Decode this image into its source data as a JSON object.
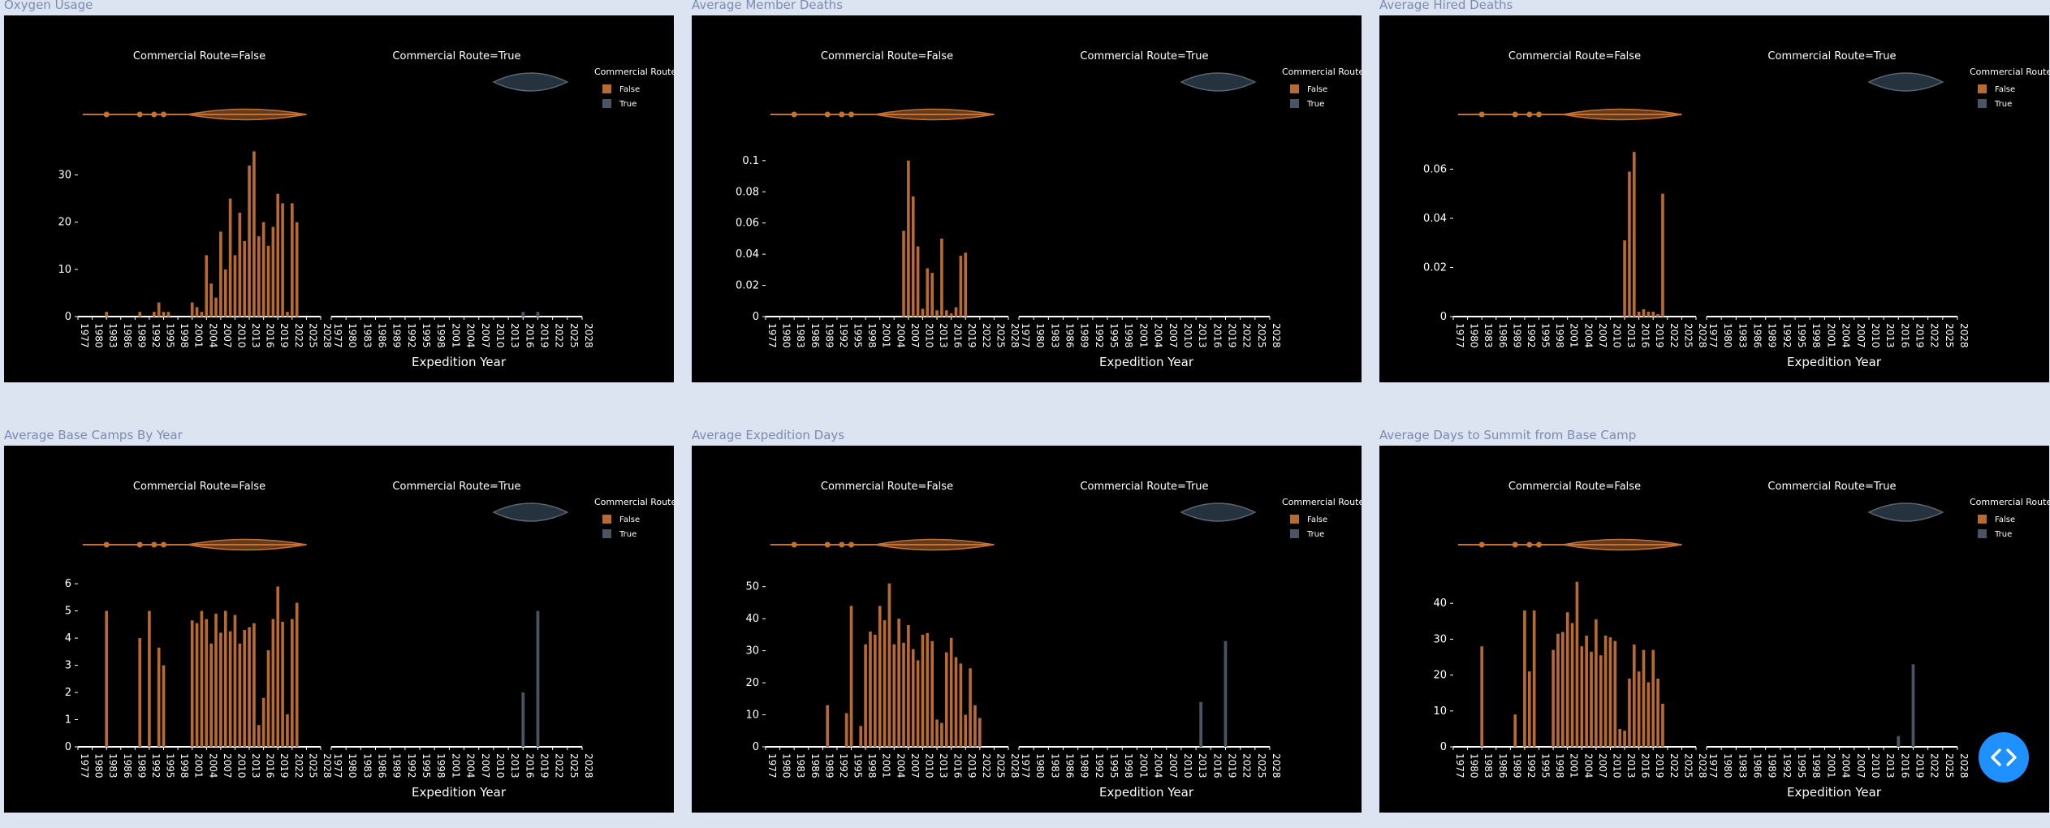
{
  "common": {
    "facet_titles": [
      "Commercial Route=False",
      "Commercial Route=True"
    ],
    "legend_title": "Commercial Route",
    "legend_items": [
      {
        "label": "False",
        "color": "#b86a33"
      },
      {
        "label": "True",
        "color": "#4a5563"
      }
    ],
    "xlabel": "Expedition Year",
    "x_ticks": [
      "1977",
      "1980",
      "1983",
      "1986",
      "1989",
      "1992",
      "1995",
      "1998",
      "2001",
      "2004",
      "2007",
      "2010",
      "2013",
      "2016",
      "2019",
      "2022",
      "2025",
      "2028"
    ],
    "xlim": [
      1977,
      2028
    ],
    "violin_false_points": [
      1983,
      1990,
      1993,
      1995
    ]
  },
  "chart_data": [
    {
      "type": "bar",
      "title": "Oxygen Usage",
      "ylim": [
        0,
        38
      ],
      "y_ticks": [
        0,
        10,
        20,
        30
      ],
      "series": [
        {
          "name": "False",
          "x": [
            1983,
            1990,
            1993,
            1994,
            1995,
            1996,
            2001,
            2002,
            2003,
            2004,
            2005,
            2006,
            2007,
            2008,
            2009,
            2010,
            2011,
            2012,
            2013,
            2014,
            2015,
            2016,
            2017,
            2018,
            2019,
            2020,
            2021,
            2022,
            2023
          ],
          "values": [
            1,
            1,
            1,
            3,
            1,
            1,
            3,
            2,
            1,
            13,
            7,
            4,
            18,
            10,
            25,
            13,
            22,
            16,
            32,
            35,
            17,
            20,
            15,
            19,
            26,
            24,
            1,
            24,
            20
          ]
        },
        {
          "name": "True",
          "x": [
            2016,
            2019
          ],
          "values": [
            1,
            1
          ]
        }
      ]
    },
    {
      "type": "bar",
      "title": "Average Member Deaths",
      "ylim": [
        0,
        0.115
      ],
      "y_ticks": [
        0,
        0.02,
        0.04,
        0.06,
        0.08,
        0.1
      ],
      "series": [
        {
          "name": "False",
          "x": [
            2006,
            2007,
            2008,
            2009,
            2010,
            2011,
            2012,
            2013,
            2014,
            2015,
            2016,
            2017,
            2018,
            2019
          ],
          "values": [
            0.055,
            0.1,
            0.077,
            0.045,
            0.005,
            0.031,
            0.028,
            0.004,
            0.05,
            0.004,
            0.002,
            0.006,
            0.039,
            0.041
          ]
        },
        {
          "name": "True",
          "x": [],
          "values": []
        }
      ]
    },
    {
      "type": "bar",
      "title": "Average Hired Deaths",
      "ylim": [
        0,
        0.073
      ],
      "y_ticks": [
        0,
        0.02,
        0.04,
        0.06
      ],
      "series": [
        {
          "name": "False",
          "x": [
            2013,
            2014,
            2015,
            2016,
            2017,
            2018,
            2019,
            2020,
            2021
          ],
          "values": [
            0.031,
            0.059,
            0.067,
            0.002,
            0.003,
            0.002,
            0.002,
            0.001,
            0.05
          ]
        },
        {
          "name": "True",
          "x": [],
          "values": []
        }
      ]
    },
    {
      "type": "bar",
      "title": "Average Base Camps By Year",
      "ylim": [
        0,
        6.6
      ],
      "y_ticks": [
        0,
        1,
        2,
        3,
        4,
        5,
        6
      ],
      "series": [
        {
          "name": "False",
          "x": [
            1983,
            1990,
            1992,
            1994,
            1995,
            2001,
            2002,
            2003,
            2004,
            2005,
            2006,
            2007,
            2008,
            2009,
            2010,
            2011,
            2012,
            2013,
            2014,
            2015,
            2016,
            2017,
            2018,
            2019,
            2020,
            2021,
            2022,
            2023
          ],
          "values": [
            5,
            4,
            5,
            3.65,
            3,
            4.65,
            4.55,
            5,
            4.7,
            3.8,
            4.9,
            4.2,
            5,
            4.25,
            4.85,
            3.8,
            4.3,
            4.4,
            4.55,
            0.8,
            1.8,
            3.55,
            4.7,
            5.9,
            4.6,
            1.2,
            4.7,
            5.3
          ]
        },
        {
          "name": "True",
          "x": [
            2016,
            2019
          ],
          "values": [
            2,
            5
          ]
        }
      ]
    },
    {
      "type": "bar",
      "title": "Average Expedition Days",
      "ylim": [
        0,
        56
      ],
      "y_ticks": [
        0,
        10,
        20,
        30,
        40,
        50
      ],
      "series": [
        {
          "name": "False",
          "x": [
            1990,
            1994,
            1995,
            1997,
            1998,
            1999,
            2000,
            2001,
            2002,
            2003,
            2004,
            2005,
            2006,
            2007,
            2008,
            2009,
            2010,
            2011,
            2012,
            2013,
            2014,
            2015,
            2016,
            2017,
            2018,
            2019,
            2020,
            2021,
            2022
          ],
          "values": [
            13,
            10.5,
            44,
            6.5,
            32,
            36,
            35,
            44,
            39.5,
            51,
            32,
            40,
            32.5,
            38,
            30.5,
            27,
            35,
            35.5,
            33,
            8.5,
            7.5,
            29.5,
            34,
            28,
            26,
            10,
            24.5,
            13,
            9
          ]
        },
        {
          "name": "True",
          "x": [
            2014,
            2019
          ],
          "values": [
            14,
            33
          ]
        }
      ]
    },
    {
      "type": "bar",
      "title": "Average Days to Summit from Base Camp",
      "ylim": [
        0,
        50
      ],
      "y_ticks": [
        0,
        10,
        20,
        30,
        40
      ],
      "series": [
        {
          "name": "False",
          "x": [
            1983,
            1990,
            1992,
            1993,
            1994,
            1998,
            1999,
            2000,
            2001,
            2002,
            2003,
            2004,
            2005,
            2006,
            2007,
            2008,
            2009,
            2010,
            2011,
            2012,
            2013,
            2014,
            2015,
            2016,
            2017,
            2018,
            2019,
            2020,
            2021
          ],
          "values": [
            28,
            9,
            38,
            21,
            38,
            27,
            31.5,
            32,
            37.5,
            34.5,
            46,
            28,
            31,
            26.5,
            35.5,
            25.5,
            31,
            30.5,
            29.5,
            5,
            4.5,
            19,
            28.5,
            21,
            27,
            18,
            27,
            19,
            12
          ]
        },
        {
          "name": "True",
          "x": [
            2016,
            2019
          ],
          "values": [
            3,
            23
          ]
        }
      ]
    }
  ],
  "nav_button": {
    "icon": "code-chevrons-icon"
  }
}
